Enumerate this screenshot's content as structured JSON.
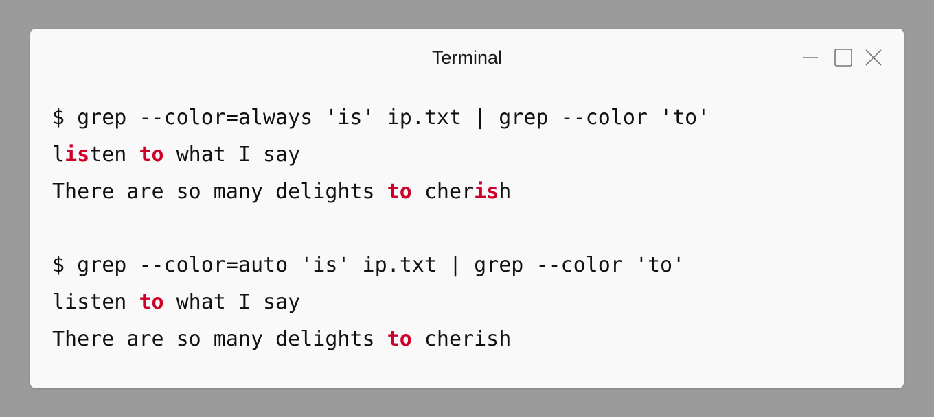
{
  "window": {
    "title": "Terminal",
    "controls": [
      "minimize-icon",
      "maximize-icon",
      "close-icon"
    ]
  },
  "colors": {
    "desktop_background": "#9b9b9b",
    "window_background": "#f9f9f9",
    "text": "#111111",
    "match_highlight": "#cc0029"
  },
  "terminal": {
    "block1": {
      "command": "$ grep --color=always 'is' ip.txt | grep --color 'to'",
      "output1": {
        "seg1": "l",
        "seg2": "is",
        "seg3": "ten ",
        "seg4": "to",
        "seg5": " what I say"
      },
      "output2": {
        "seg1": "There are so many delights ",
        "seg2": "to",
        "seg3": " cher",
        "seg4": "is",
        "seg5": "h"
      }
    },
    "block2": {
      "command": "$ grep --color=auto 'is' ip.txt | grep --color 'to'",
      "output1": {
        "seg1": "listen ",
        "seg2": "to",
        "seg3": " what I say"
      },
      "output2": {
        "seg1": "There are so many delights ",
        "seg2": "to",
        "seg3": " cherish"
      }
    }
  }
}
